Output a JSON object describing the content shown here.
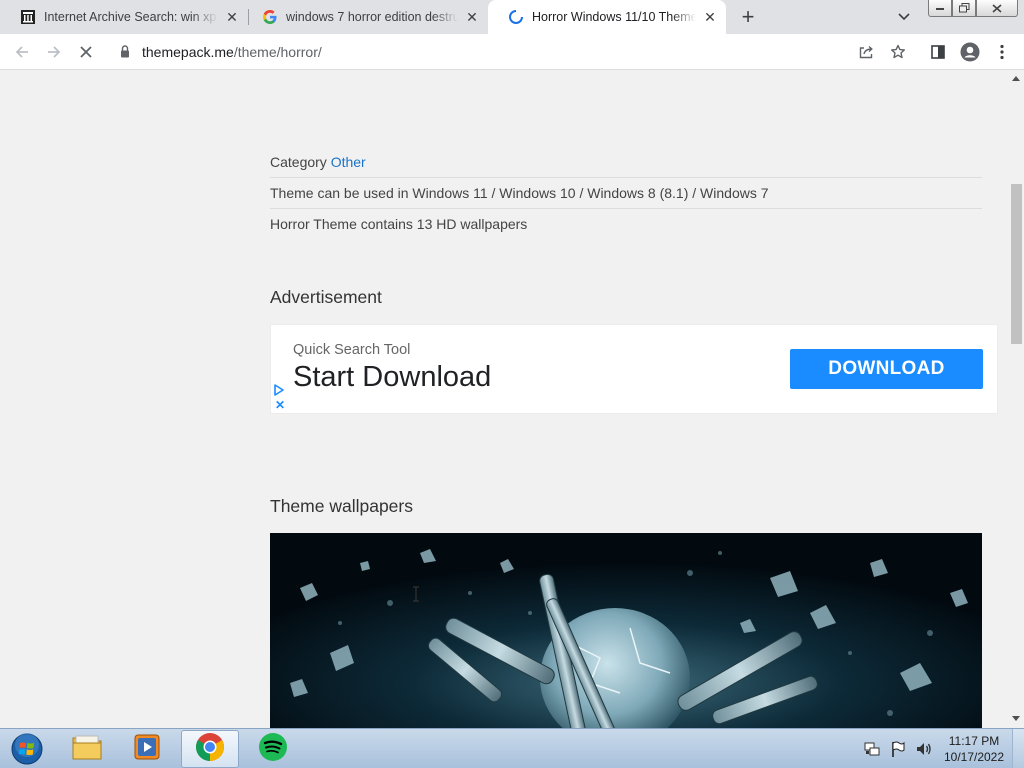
{
  "browser": {
    "tabs": [
      {
        "title": "Internet Archive Search: win xp h",
        "favicon": "internet-archive-icon",
        "active": false
      },
      {
        "title": "windows 7 horror edition destruc",
        "favicon": "google-icon",
        "active": false
      },
      {
        "title": "Horror Windows 11/10 Theme - ",
        "favicon": "loading-spinner-icon",
        "active": true
      }
    ],
    "new_tab": "+",
    "address": {
      "domain": "themepack.me",
      "path": "/theme/horror/"
    }
  },
  "page": {
    "category_label": "Category",
    "category_link": "Other",
    "compat": "Theme can be used in Windows 11 / Windows 10 / Windows 8 (8.1) / Windows 7",
    "contents": "Horror Theme contains 13 HD wallpapers",
    "advertisement_heading": "Advertisement",
    "ad": {
      "subtitle": "Quick Search Tool",
      "title": "Start Download",
      "button": "DOWNLOAD",
      "close": "✕"
    },
    "wallpapers_heading": "Theme wallpapers"
  },
  "taskbar": {
    "items": [
      {
        "name": "start-button",
        "icon": "windows-orb-icon"
      },
      {
        "name": "explorer",
        "icon": "folder-icon"
      },
      {
        "name": "media-player",
        "icon": "media-player-icon"
      },
      {
        "name": "chrome",
        "icon": "chrome-icon",
        "active": true
      },
      {
        "name": "spotify",
        "icon": "spotify-icon"
      }
    ],
    "clock": {
      "time": "11:17 PM",
      "date": "10/17/2022"
    }
  },
  "colors": {
    "link": "#1a73c8",
    "ad_button": "#1a8cff",
    "spotify": "#1db954"
  }
}
